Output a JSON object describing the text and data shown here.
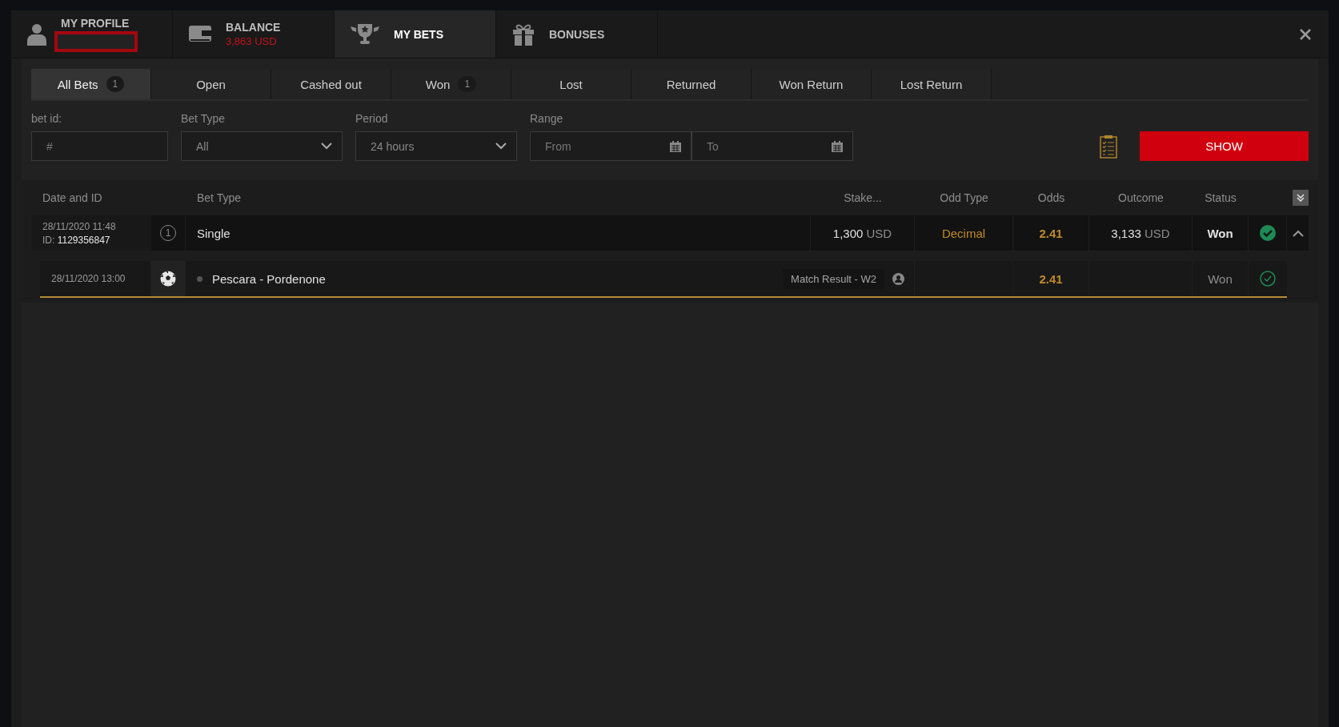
{
  "top_tabs": [
    {
      "kind": "profile",
      "label": "MY PROFILE",
      "selected": false
    },
    {
      "kind": "balance",
      "label": "BALANCE",
      "sub": "3,863 USD",
      "selected": false
    },
    {
      "kind": "bets",
      "label": "MY BETS",
      "selected": true
    },
    {
      "kind": "bonuses",
      "label": "BONUSES",
      "selected": false
    }
  ],
  "filter_tabs": [
    {
      "label": "All Bets",
      "count": "1",
      "selected": true
    },
    {
      "label": "Open",
      "selected": false
    },
    {
      "label": "Cashed out",
      "selected": false
    },
    {
      "label": "Won",
      "count": "1",
      "selected": false
    },
    {
      "label": "Lost",
      "selected": false
    },
    {
      "label": "Returned",
      "selected": false
    },
    {
      "label": "Won Return",
      "selected": false
    },
    {
      "label": "Lost Return",
      "selected": false
    }
  ],
  "filters": {
    "bet_id": {
      "label": "bet id:",
      "placeholder": "#"
    },
    "bet_type": {
      "label": "Bet Type",
      "value": "All"
    },
    "period": {
      "label": "Period",
      "value": "24 hours"
    },
    "range": {
      "label": "Range",
      "from_placeholder": "From",
      "to_placeholder": "To"
    }
  },
  "show_button": "SHOW",
  "table": {
    "columns": [
      "Date and ID",
      "Bet Type",
      "Stake...",
      "Odd Type",
      "Odds",
      "Outcome",
      "Status"
    ],
    "bets": [
      {
        "date": "28/11/2020 11:48",
        "id_label": "ID:",
        "id": "1129356847",
        "count": "1",
        "type": "Single",
        "stake": "1,300",
        "stake_currency": "USD",
        "odd_type": "Decimal",
        "odds": "2.41",
        "outcome": "3,133",
        "outcome_currency": "USD",
        "status": "Won",
        "won": true,
        "expanded": true,
        "events": [
          {
            "date": "28/11/2020 13:00",
            "match": "Pescara - Pordenone",
            "market": "Match Result - W2",
            "odds": "2.41",
            "status": "Won",
            "won": true
          }
        ]
      }
    ]
  }
}
